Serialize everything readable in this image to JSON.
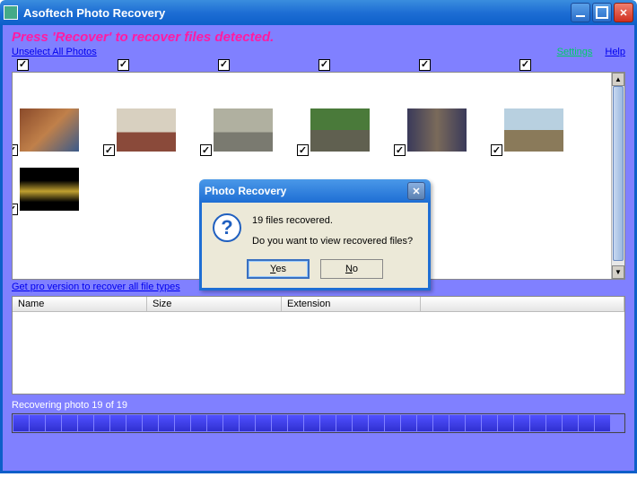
{
  "app": {
    "title": "Asoftech Photo Recovery"
  },
  "header": {
    "instruction": "Press 'Recover' to recover files detected.",
    "unselect_link": "Unselect All Photos",
    "settings_link": "Settings",
    "help_link": "Help"
  },
  "thumbnails": {
    "top_checkboxes": 6,
    "rows": [
      {
        "count": 6
      },
      {
        "count": 1
      }
    ]
  },
  "pro_link": "Get pro version to recover all file types",
  "table": {
    "columns": [
      "Name",
      "Size",
      "Extension",
      ""
    ]
  },
  "status": {
    "text": "Recovering photo 19 of 19",
    "progress_segments": 37
  },
  "dialog": {
    "title": "Photo Recovery",
    "line1": "19 files recovered.",
    "line2": "Do you want to view recovered files?",
    "yes": "Yes",
    "no": "No"
  }
}
